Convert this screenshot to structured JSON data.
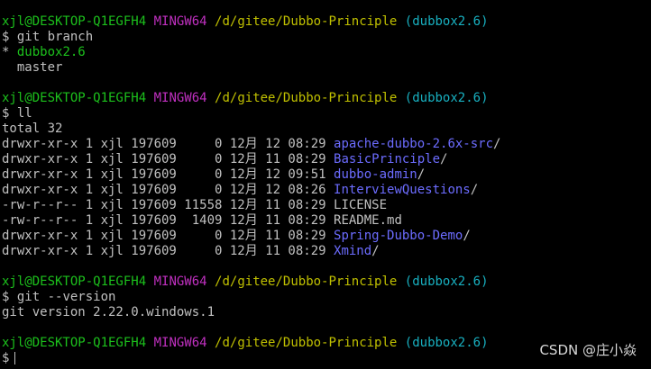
{
  "prompt_parts": {
    "user_host": "xjl@DESKTOP-Q1EGFH4",
    "shell": "MINGW64",
    "path": "/d/gitee/Dubbo-Principle",
    "branch": "(dubbox2.6)",
    "symbol": "$"
  },
  "commands": {
    "cmd1": "git branch",
    "cmd2": "ll",
    "cmd3": "git --version"
  },
  "branch_list": {
    "current_marker": "*",
    "current": "dubbox2.6",
    "other": "master"
  },
  "ll_output": {
    "total": "total 32",
    "rows": [
      {
        "meta": "drwxr-xr-x 1 xjl 197609     0 12月 12 08:29 ",
        "name": "apache-dubbo-2.6x-src",
        "suffix": "/"
      },
      {
        "meta": "drwxr-xr-x 1 xjl 197609     0 12月 11 08:29 ",
        "name": "BasicPrinciple",
        "suffix": "/"
      },
      {
        "meta": "drwxr-xr-x 1 xjl 197609     0 12月 12 09:51 ",
        "name": "dubbo-admin",
        "suffix": "/"
      },
      {
        "meta": "drwxr-xr-x 1 xjl 197609     0 12月 12 08:26 ",
        "name": "InterviewQuestions",
        "suffix": "/"
      },
      {
        "meta": "-rw-r--r-- 1 xjl 197609 11558 12月 11 08:29 ",
        "name": "LICENSE",
        "suffix": ""
      },
      {
        "meta": "-rw-r--r-- 1 xjl 197609  1409 12月 11 08:29 ",
        "name": "README.md",
        "suffix": ""
      },
      {
        "meta": "drwxr-xr-x 1 xjl 197609     0 12月 11 08:29 ",
        "name": "Spring-Dubbo-Demo",
        "suffix": "/"
      },
      {
        "meta": "drwxr-xr-x 1 xjl 197609     0 12月 11 08:29 ",
        "name": "Xmind",
        "suffix": "/"
      }
    ]
  },
  "version_output": "git version 2.22.0.windows.1",
  "watermark": "CSDN @庄小焱",
  "colors": {
    "background": "#000000",
    "text": "#c0c0c0",
    "user_host": "#1cc01c",
    "shell": "#c030c0",
    "path": "#c0c000",
    "branch": "#18b0c0",
    "directory": "#6c6cff"
  }
}
